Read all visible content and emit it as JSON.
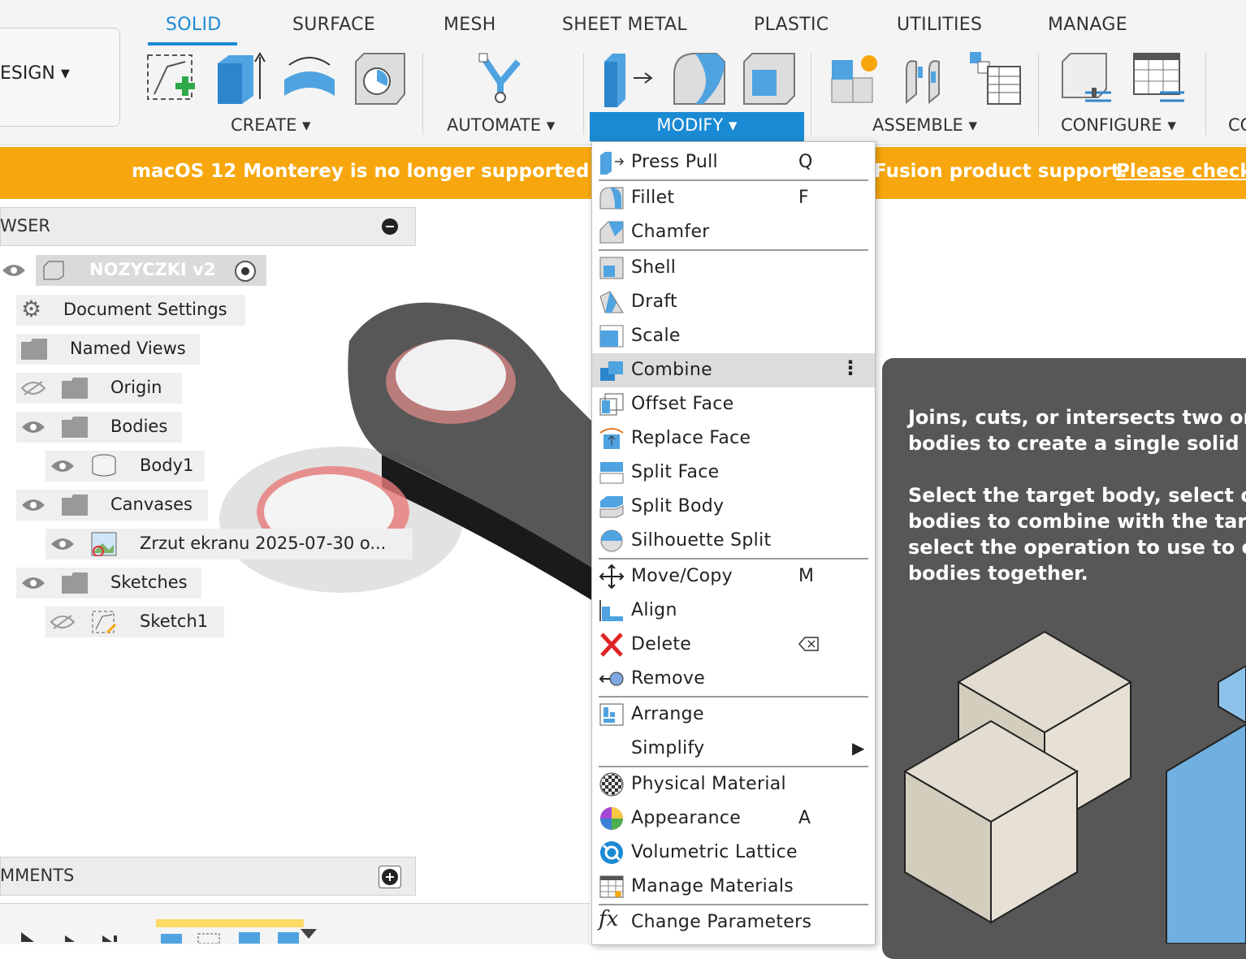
{
  "toolbar": {
    "workspace_label": "ESIGN",
    "tabs": [
      "SOLID",
      "SURFACE",
      "MESH",
      "SHEET METAL",
      "PLASTIC",
      "UTILITIES",
      "MANAGE"
    ],
    "groups": {
      "create": "CREATE",
      "automate": "AUTOMATE",
      "modify": "MODIFY",
      "assemble": "ASSEMBLE",
      "configure": "CONFIGURE",
      "partial": "CO"
    },
    "accent_color": "#1a8ad4"
  },
  "banner": {
    "text_left": "macOS 12 Monterey is no longer supported by",
    "text_right": "Fusion product support.",
    "link": "Please check",
    "color": "#f7a70d"
  },
  "browser": {
    "title": "WSER",
    "root": "NOZYCZKI v2",
    "items": {
      "document_settings": "Document Settings",
      "named_views": "Named Views",
      "origin": "Origin",
      "bodies": "Bodies",
      "body1": "Body1",
      "canvases": "Canvases",
      "canvas1": "Zrzut ekranu 2025-07-30 o...",
      "sketches": "Sketches",
      "sketch1": "Sketch1"
    }
  },
  "comments": {
    "title": "MMENTS"
  },
  "menu": {
    "items": [
      {
        "label": "Press Pull",
        "key": "Q"
      },
      {
        "label": "Fillet",
        "key": "F"
      },
      {
        "label": "Chamfer",
        "key": ""
      },
      {
        "label": "Shell",
        "key": ""
      },
      {
        "label": "Draft",
        "key": ""
      },
      {
        "label": "Scale",
        "key": ""
      },
      {
        "label": "Combine",
        "key": ""
      },
      {
        "label": "Offset Face",
        "key": ""
      },
      {
        "label": "Replace Face",
        "key": ""
      },
      {
        "label": "Split Face",
        "key": ""
      },
      {
        "label": "Split Body",
        "key": ""
      },
      {
        "label": "Silhouette Split",
        "key": ""
      },
      {
        "label": "Move/Copy",
        "key": "M"
      },
      {
        "label": "Align",
        "key": ""
      },
      {
        "label": "Delete",
        "key": ""
      },
      {
        "label": "Remove",
        "key": ""
      },
      {
        "label": "Arrange",
        "key": ""
      },
      {
        "label": "Simplify",
        "key": ""
      },
      {
        "label": "Physical Material",
        "key": ""
      },
      {
        "label": "Appearance",
        "key": "A"
      },
      {
        "label": "Volumetric Lattice",
        "key": ""
      },
      {
        "label": "Manage Materials",
        "key": ""
      },
      {
        "label": "Change Parameters",
        "key": ""
      }
    ],
    "highlighted": "Combine"
  },
  "tooltip": {
    "p1_line1": "Joins, cuts, or intersects two or m",
    "p1_line2": "bodies to create a single solid bo",
    "p2_line1": "Select the target body, select one",
    "p2_line2": "bodies to combine with the targe",
    "p2_line3": "select the operation to use to com",
    "p2_line4": "bodies together."
  }
}
